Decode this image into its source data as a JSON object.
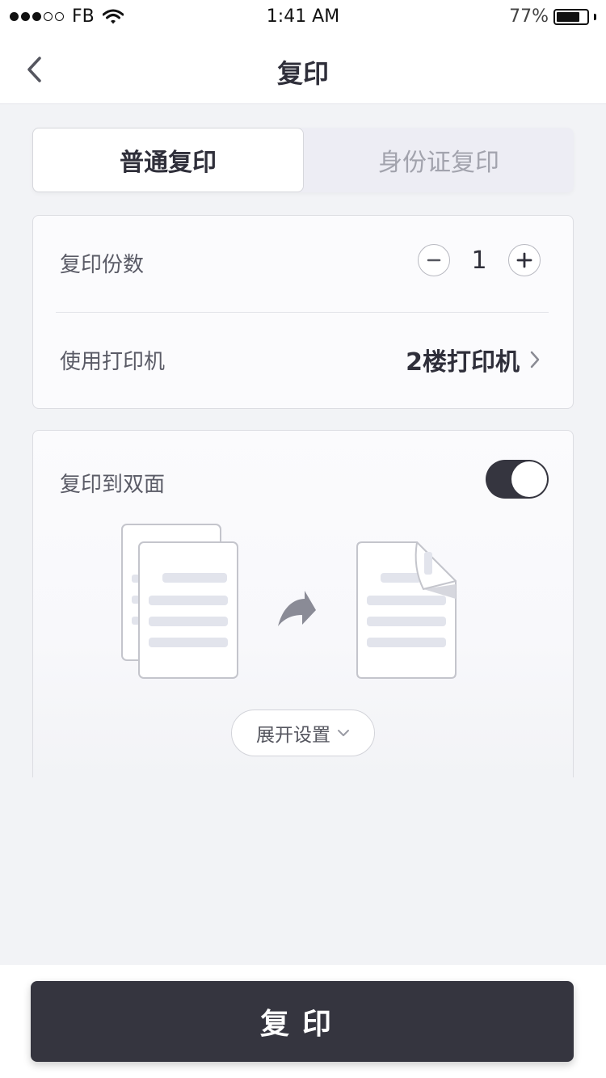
{
  "status_bar": {
    "carrier": "FB",
    "time": "1:41 AM",
    "battery_percent_label": "77%",
    "battery_level": 0.77
  },
  "nav": {
    "title": "复印"
  },
  "tabs": [
    {
      "label": "普通复印",
      "active": true
    },
    {
      "label": "身份证复印",
      "active": false
    }
  ],
  "copies": {
    "label": "复印份数",
    "value": "1"
  },
  "printer": {
    "label": "使用打印机",
    "name": "2楼打印机"
  },
  "duplex": {
    "label": "复印到双面",
    "enabled": true
  },
  "expand": {
    "label": "展开设置"
  },
  "action": {
    "label": "复印"
  },
  "colors": {
    "primary_dark": "#35353f",
    "background": "#f2f3f6",
    "inactive_text": "#a2a3ad"
  }
}
